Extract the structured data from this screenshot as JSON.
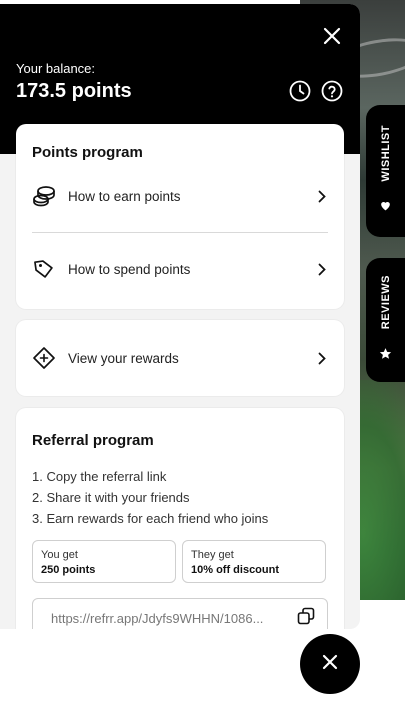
{
  "header": {
    "balance_label": "Your balance:",
    "balance_value": "173.5 points",
    "icons": [
      "close-icon",
      "history-clock-icon",
      "help-question-icon"
    ]
  },
  "points_program": {
    "title": "Points program",
    "items": [
      {
        "label": "How to earn points",
        "icon": "coins-icon"
      },
      {
        "label": "How to spend points",
        "icon": "price-tag-icon"
      }
    ]
  },
  "rewards": {
    "label": "View your rewards",
    "icon": "ticket-icon"
  },
  "referral": {
    "title": "Referral program",
    "steps": [
      "1. Copy the referral link",
      "2. Share it with your friends",
      "3. Earn rewards for each friend who joins"
    ],
    "you_get_label": "You get",
    "you_get_value": "250 points",
    "they_get_label": "They get",
    "they_get_value": "10% off discount",
    "link": "https://refrr.app/Jdyfs9WHHN/1086...",
    "copy_icon": "copy-icon"
  },
  "side_tabs": {
    "wishlist": "WISHLIST",
    "reviews": "REVIEWS"
  },
  "colors": {
    "header_bg": "#000000",
    "panel_bg": "#f3f3f3",
    "card_bg": "#ffffff",
    "accent": "#000000"
  }
}
